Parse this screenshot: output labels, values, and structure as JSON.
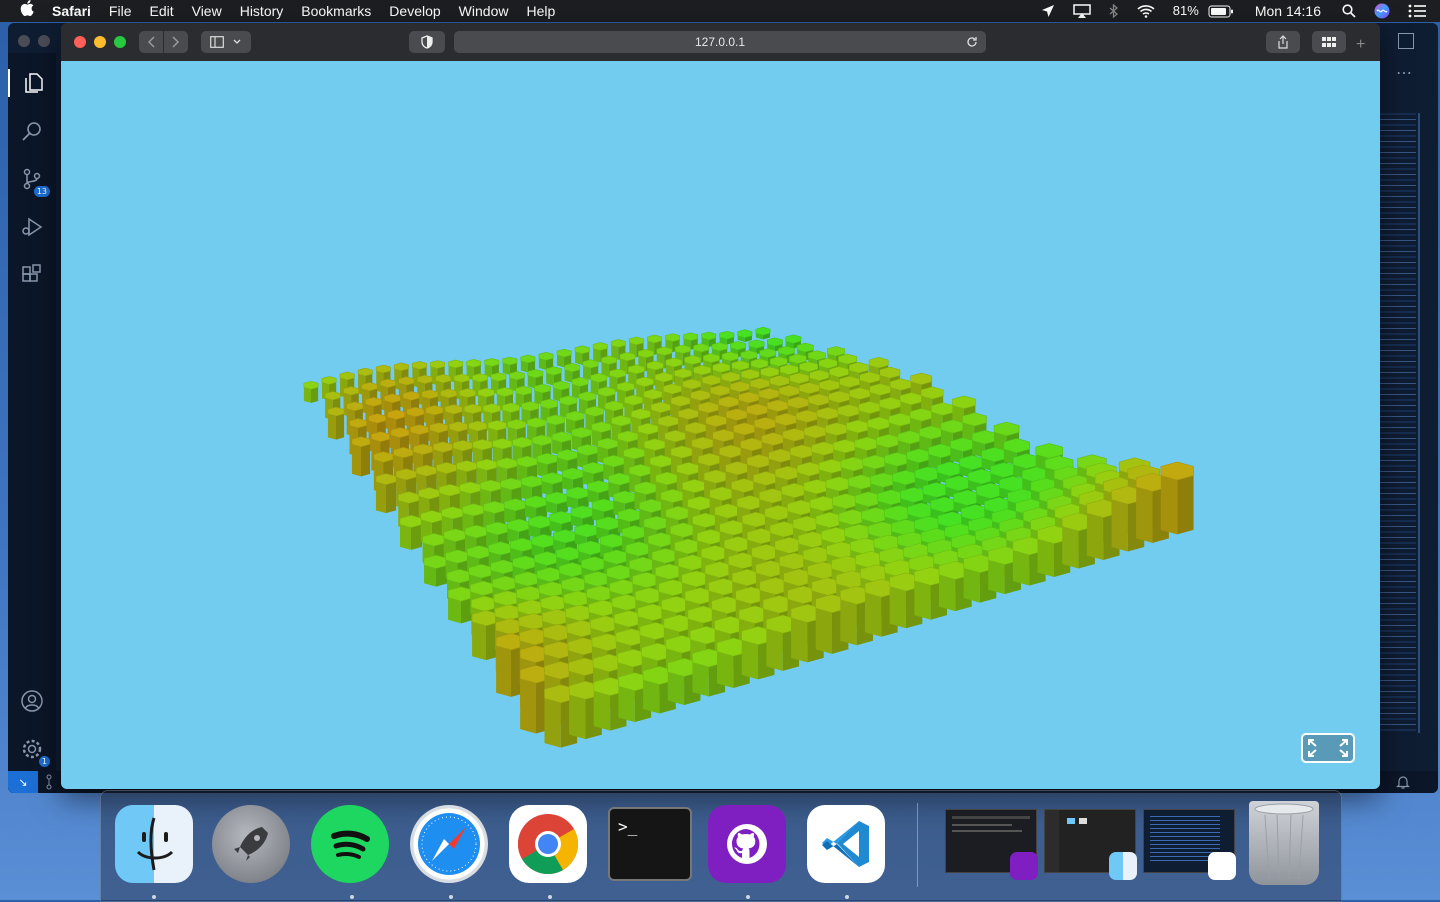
{
  "menubar": {
    "apple_icon": "apple-icon",
    "app_name": "Safari",
    "items": [
      "File",
      "Edit",
      "View",
      "History",
      "Bookmarks",
      "Develop",
      "Window",
      "Help"
    ],
    "battery": "81%",
    "clock": "Mon 14:16"
  },
  "vscode": {
    "scm_badge": "13",
    "settings_badge": "1"
  },
  "safari": {
    "url": "127.0.0.1",
    "accent_colors": {
      "close": "#fe5f57",
      "minimize": "#febc2e",
      "zoom": "#28c840"
    }
  },
  "webpage": {
    "background": "#72ccef",
    "scene": "hexagonal-terrain",
    "palette": {
      "low": "#42d620",
      "mid": "#8cc810",
      "high": "#c09a0e"
    }
  },
  "dock": {
    "apps": [
      {
        "name": "finder-icon",
        "running": true
      },
      {
        "name": "launchpad-icon",
        "running": false
      },
      {
        "name": "spotify-icon",
        "running": true
      },
      {
        "name": "safari-icon",
        "running": true
      },
      {
        "name": "chrome-icon",
        "running": true
      },
      {
        "name": "terminal-icon",
        "running": false
      },
      {
        "name": "github-desktop-icon",
        "running": true
      },
      {
        "name": "vscode-icon",
        "running": true
      }
    ],
    "terminal_prompt": ">_"
  }
}
